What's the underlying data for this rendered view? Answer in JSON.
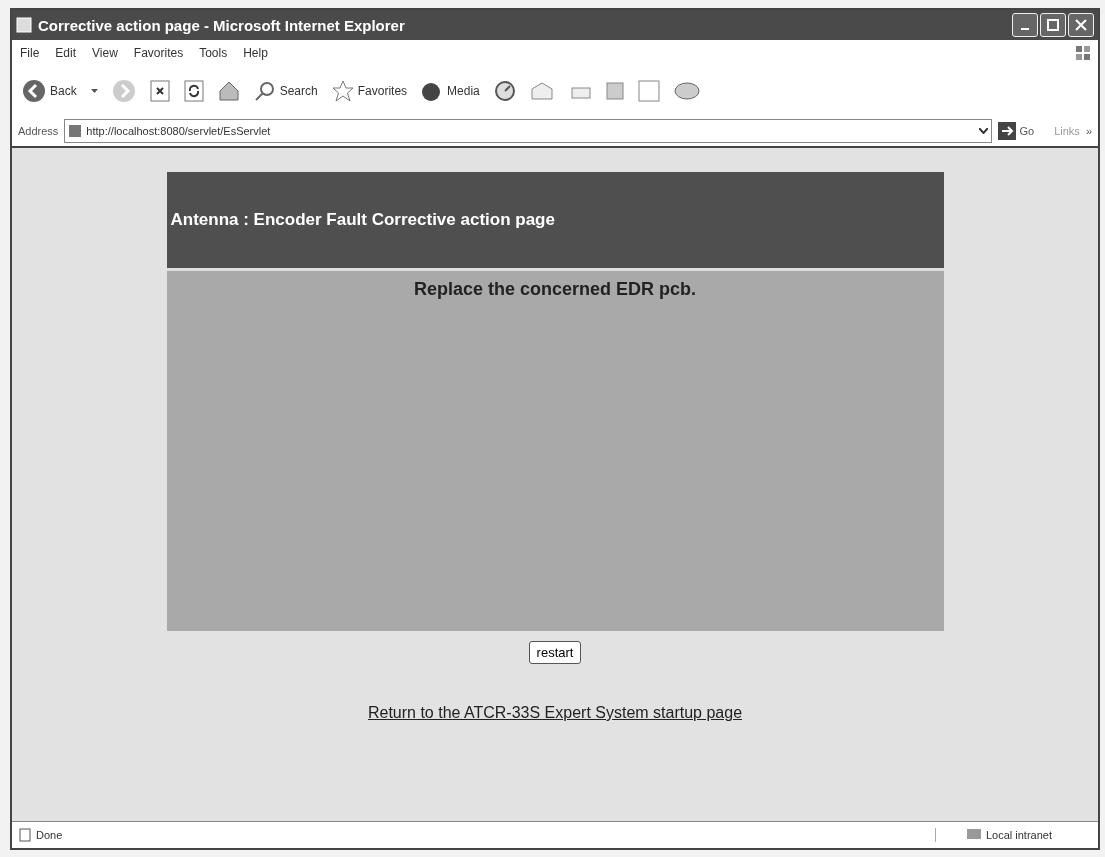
{
  "window": {
    "title": "Corrective action page - Microsoft Internet Explorer"
  },
  "menu": [
    "File",
    "Edit",
    "View",
    "Favorites",
    "Tools",
    "Help"
  ],
  "toolbar": {
    "back": "Back",
    "search": "Search",
    "favorites": "Favorites",
    "media": "Media"
  },
  "address": {
    "label": "Address",
    "url": "http://localhost:8080/servlet/EsServlet",
    "go": "Go",
    "links": "Links",
    "more": "»"
  },
  "page": {
    "header": "Antenna : Encoder Fault Corrective action page",
    "instruction": "Replace the concerned EDR pcb.",
    "button": "restart",
    "link": "Return to the ATCR-33S Expert System startup page"
  },
  "status_bar": {
    "text": "Done",
    "zone": "Local intranet"
  }
}
